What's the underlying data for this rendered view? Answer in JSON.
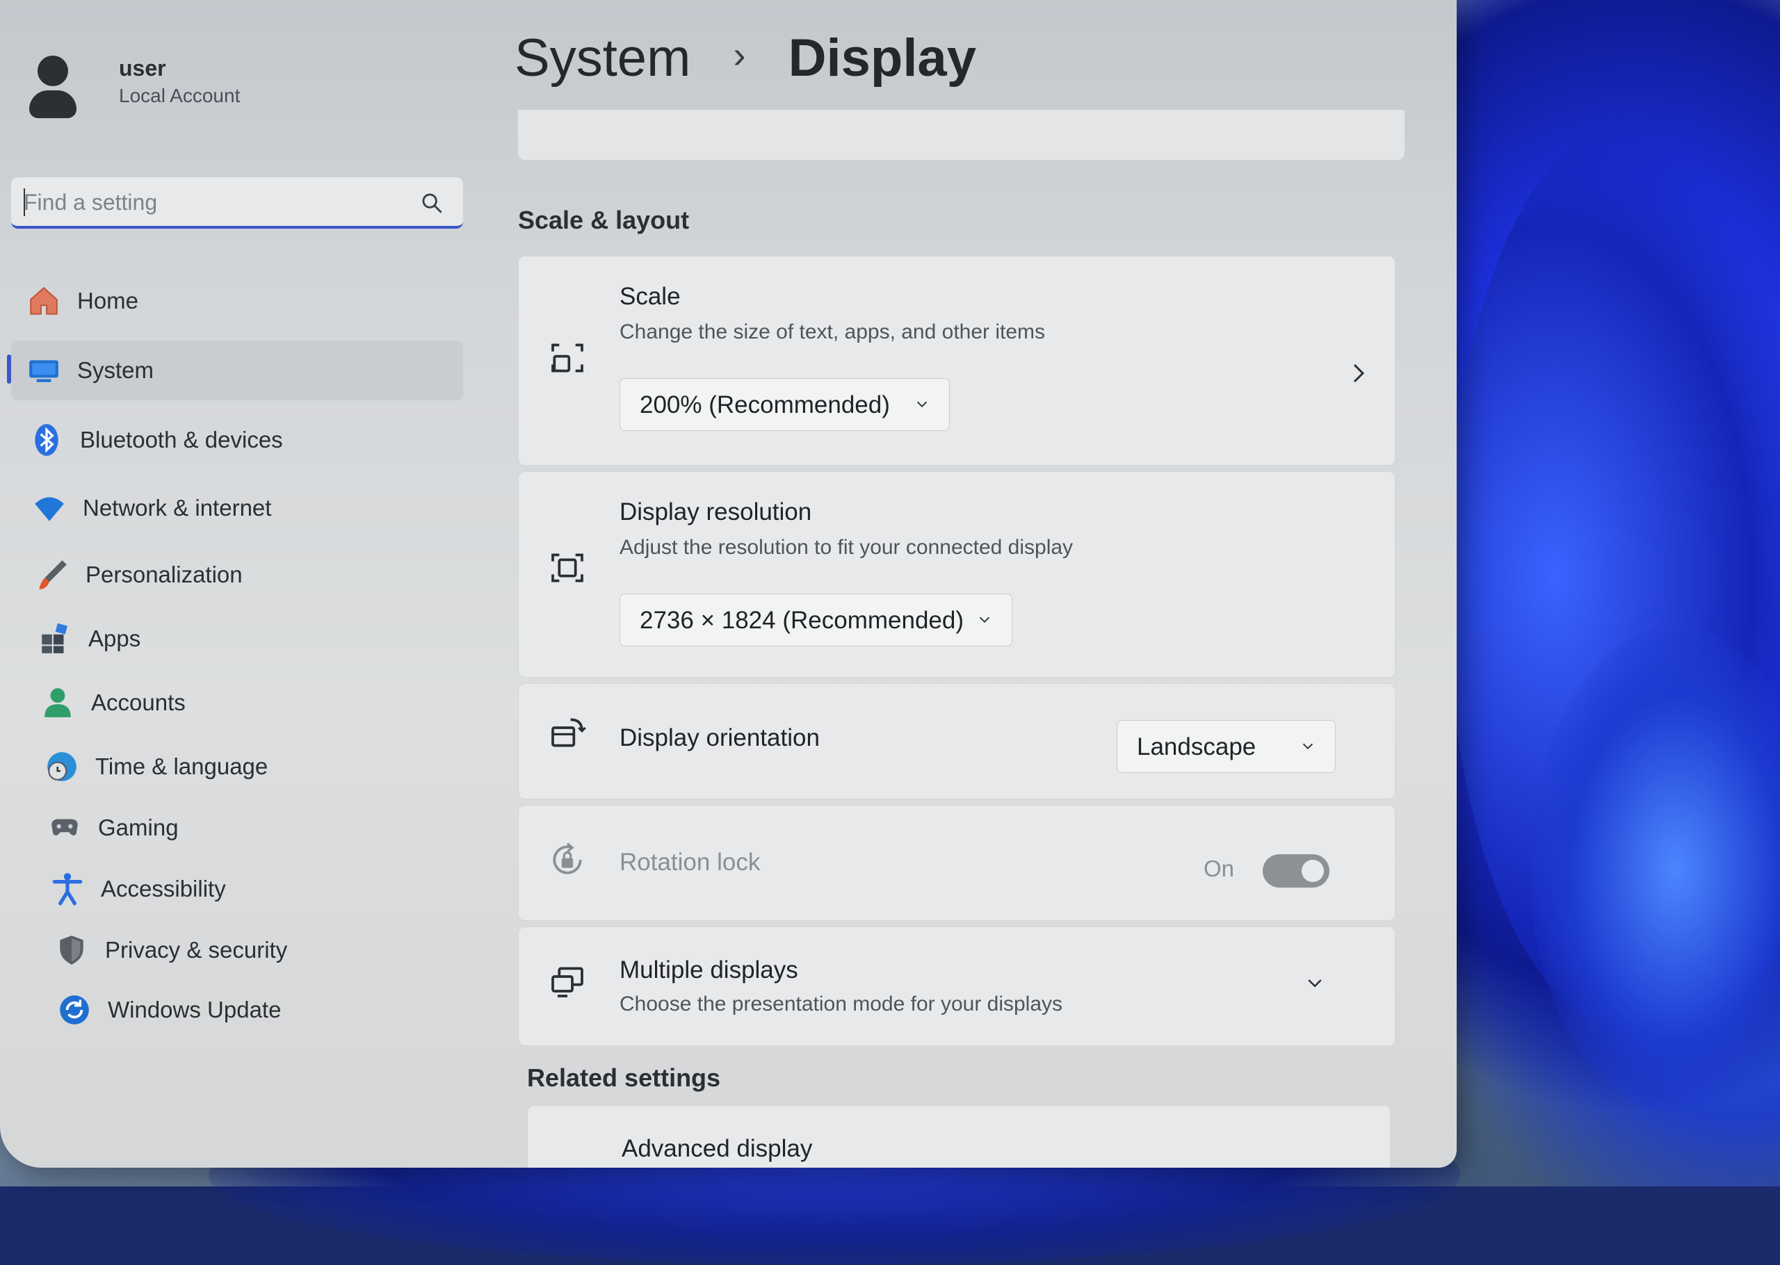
{
  "user": {
    "name": "user",
    "account_type": "Local Account"
  },
  "search": {
    "placeholder": "Find a setting",
    "icon": "search-icon"
  },
  "sidebar": {
    "items": [
      {
        "label": "Home",
        "icon": "home-icon",
        "selected": false
      },
      {
        "label": "System",
        "icon": "system-icon",
        "selected": true
      },
      {
        "label": "Bluetooth & devices",
        "icon": "bluetooth-icon",
        "selected": false
      },
      {
        "label": "Network & internet",
        "icon": "wifi-icon",
        "selected": false
      },
      {
        "label": "Personalization",
        "icon": "brush-icon",
        "selected": false
      },
      {
        "label": "Apps",
        "icon": "apps-icon",
        "selected": false
      },
      {
        "label": "Accounts",
        "icon": "accounts-icon",
        "selected": false
      },
      {
        "label": "Time & language",
        "icon": "globe-clock-icon",
        "selected": false
      },
      {
        "label": "Gaming",
        "icon": "gamepad-icon",
        "selected": false
      },
      {
        "label": "Accessibility",
        "icon": "accessibility-icon",
        "selected": false
      },
      {
        "label": "Privacy & security",
        "icon": "shield-icon",
        "selected": false
      },
      {
        "label": "Windows Update",
        "icon": "update-icon",
        "selected": false
      }
    ]
  },
  "breadcrumb": {
    "parent": "System",
    "separator": "›",
    "current": "Display"
  },
  "sections": {
    "scale_layout": "Scale & layout",
    "related": "Related settings"
  },
  "scale": {
    "title": "Scale",
    "subtitle": "Change the size of text, apps, and other items",
    "value": "200% (Recommended)"
  },
  "resolution": {
    "title": "Display resolution",
    "subtitle": "Adjust the resolution to fit your connected display",
    "value": "2736 × 1824 (Recommended)"
  },
  "orientation": {
    "title": "Display orientation",
    "value": "Landscape"
  },
  "rotation_lock": {
    "title": "Rotation lock",
    "state_label": "On",
    "enabled": false,
    "toggled_on": true
  },
  "multiple_displays": {
    "title": "Multiple displays",
    "subtitle": "Choose the presentation mode for your displays"
  },
  "related": {
    "first_item": "Advanced display"
  },
  "colors": {
    "accent": "#3b56c9",
    "window_bg": "#dcdedf",
    "card_bg": "#e8e9ea",
    "desktop_bloom": "#1b2fd8"
  }
}
